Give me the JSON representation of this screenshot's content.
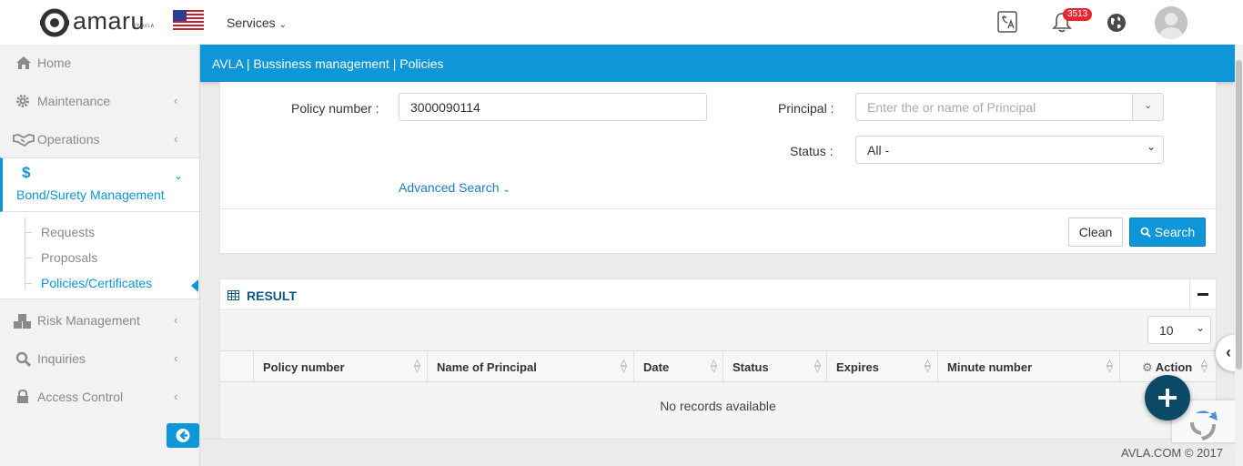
{
  "header": {
    "logo_text": "amaru",
    "logo_sub": "BY AVLA",
    "services_label": "Services",
    "notifications_count": "3513"
  },
  "sidebar": {
    "items": [
      {
        "label": "Home",
        "icon": "home-icon"
      },
      {
        "label": "Maintenance",
        "icon": "gear-icon"
      },
      {
        "label": "Operations",
        "icon": "handshake-icon"
      },
      {
        "label": "Bond/Surety Management",
        "icon": "dollar-icon"
      },
      {
        "label": "Risk Management",
        "icon": "cubes-icon"
      },
      {
        "label": "Inquiries",
        "icon": "search-icon"
      },
      {
        "label": "Access Control",
        "icon": "lock-icon"
      }
    ],
    "submenu": [
      "Requests",
      "Proposals",
      "Policies/Certificates"
    ]
  },
  "breadcrumb": "AVLA | Bussiness management | Policies",
  "search": {
    "policy_number_label": "Policy number :",
    "policy_number_value": "3000090114",
    "principal_label": "Principal :",
    "principal_placeholder": "Enter the or name of Principal",
    "status_label": "Status :",
    "status_value": "All -",
    "advanced_label": "Advanced Search",
    "clean_label": "Clean",
    "search_label": "Search"
  },
  "result": {
    "title": "RESULT",
    "page_size": "10",
    "columns": [
      "Policy number",
      "Name of Principal",
      "Date",
      "Status",
      "Expires",
      "Minute number",
      "Action"
    ],
    "empty_text": "No records available"
  },
  "footer": "AVLA.COM © 2017",
  "colors": {
    "accent": "#0e96d8",
    "fab": "#0b4a66",
    "badge": "#e7262d"
  }
}
